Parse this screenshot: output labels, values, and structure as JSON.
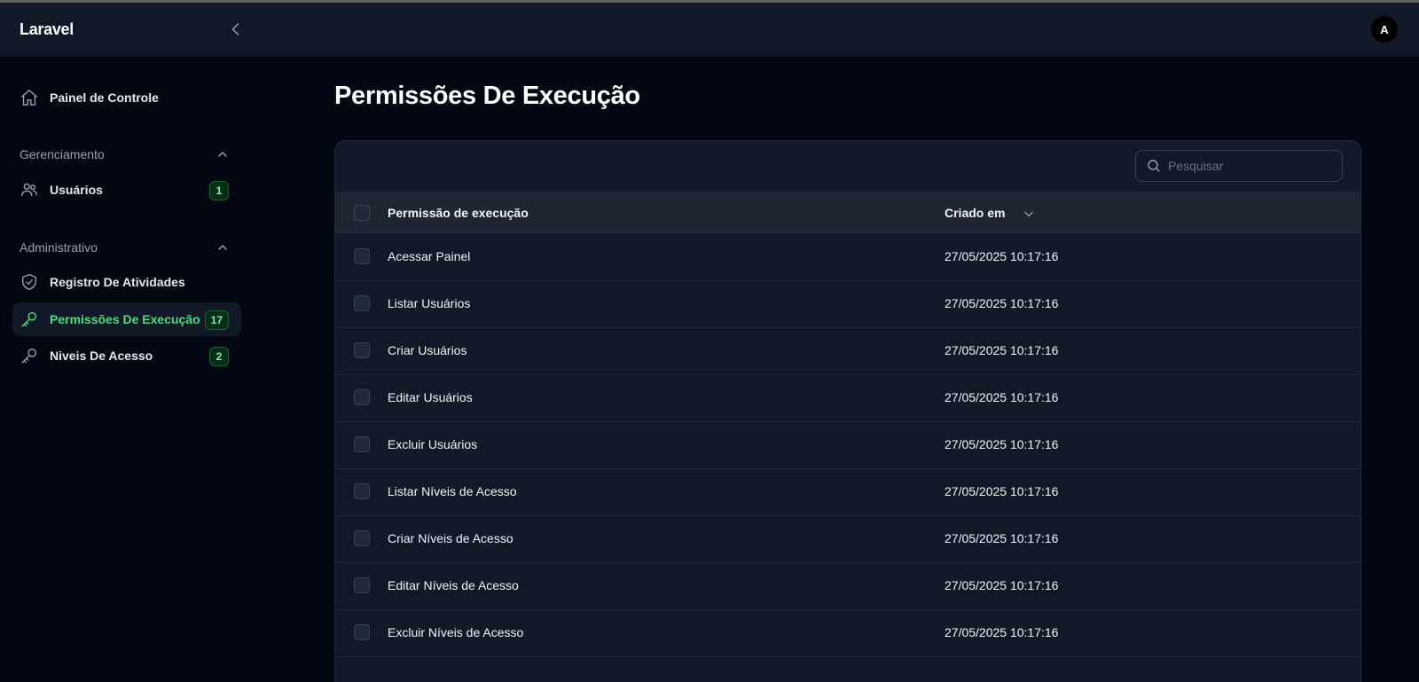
{
  "app": {
    "brand": "Laravel",
    "user_initial": "A"
  },
  "sidebar": {
    "dashboard": {
      "label": "Painel de Controle"
    },
    "groups": [
      {
        "label": "Gerenciamento"
      },
      {
        "label": "Administrativo"
      }
    ],
    "items": [
      {
        "label": "Usuários",
        "badge": "1",
        "icon": "users-icon"
      },
      {
        "label": "Registro De Atividades",
        "icon": "shield-check-icon"
      },
      {
        "label": "Permissões De Execução",
        "badge": "17",
        "icon": "key-icon",
        "active": true
      },
      {
        "label": "Niveis De Acesso",
        "badge": "2",
        "icon": "key-icon"
      }
    ]
  },
  "page": {
    "title": "Permissões De Execução"
  },
  "search": {
    "placeholder": "Pesquisar"
  },
  "table": {
    "columns": [
      "Permissão de execução",
      "Criado em"
    ],
    "rows": [
      {
        "name": "Acessar Painel",
        "created": "27/05/2025 10:17:16"
      },
      {
        "name": "Listar Usuários",
        "created": "27/05/2025 10:17:16"
      },
      {
        "name": "Criar Usuários",
        "created": "27/05/2025 10:17:16"
      },
      {
        "name": "Editar Usuários",
        "created": "27/05/2025 10:17:16"
      },
      {
        "name": "Excluir Usuários",
        "created": "27/05/2025 10:17:16"
      },
      {
        "name": "Listar Níveis de Acesso",
        "created": "27/05/2025 10:17:16"
      },
      {
        "name": "Criar Níveis de Acesso",
        "created": "27/05/2025 10:17:16"
      },
      {
        "name": "Editar Níveis de Acesso",
        "created": "27/05/2025 10:17:16"
      },
      {
        "name": "Excluir Níveis de Acesso",
        "created": "27/05/2025 10:17:16"
      }
    ]
  },
  "colors": {
    "accent": "#4ade80",
    "background": "#030712",
    "surface": "#111827"
  }
}
